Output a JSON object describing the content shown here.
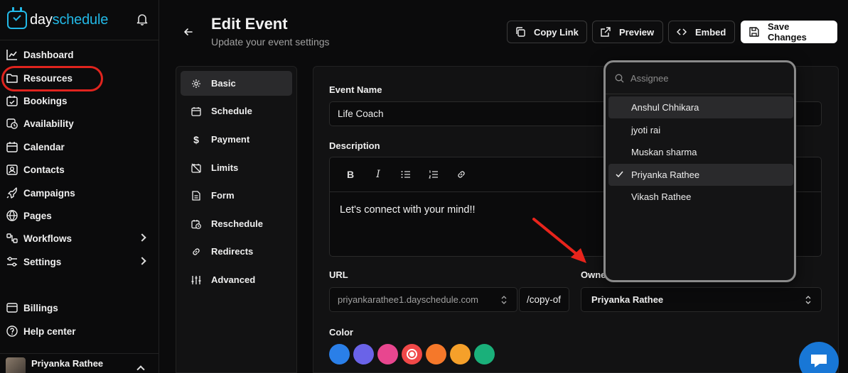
{
  "brand": {
    "name_part1": "day",
    "name_part2": "schedule"
  },
  "sidebar": {
    "items": [
      {
        "label": "Dashboard",
        "icon": "chart-icon"
      },
      {
        "label": "Resources",
        "icon": "folder-icon"
      },
      {
        "label": "Bookings",
        "icon": "calendar-check-icon"
      },
      {
        "label": "Availability",
        "icon": "clock-icon"
      },
      {
        "label": "Calendar",
        "icon": "calendar-icon"
      },
      {
        "label": "Contacts",
        "icon": "contact-icon"
      },
      {
        "label": "Campaigns",
        "icon": "rocket-icon"
      },
      {
        "label": "Pages",
        "icon": "globe-icon"
      },
      {
        "label": "Workflows",
        "icon": "workflow-icon"
      },
      {
        "label": "Settings",
        "icon": "settings-icon"
      },
      {
        "label": "Billings",
        "icon": "credit-card-icon"
      },
      {
        "label": "Help center",
        "icon": "help-icon"
      }
    ],
    "user": {
      "name": "Priyanka Rathee"
    }
  },
  "header": {
    "title": "Edit Event",
    "subtitle": "Update your event settings",
    "copy_link": "Copy Link",
    "preview": "Preview",
    "embed": "Embed",
    "save": "Save Changes"
  },
  "subnav": {
    "items": [
      {
        "label": "Basic",
        "active": true
      },
      {
        "label": "Schedule"
      },
      {
        "label": "Payment"
      },
      {
        "label": "Limits"
      },
      {
        "label": "Form"
      },
      {
        "label": "Reschedule"
      },
      {
        "label": "Redirects"
      },
      {
        "label": "Advanced"
      }
    ]
  },
  "form": {
    "event_name_label": "Event Name",
    "event_name_value": "Life Coach",
    "description_label": "Description",
    "description_value": "Let's connect with your mind!!",
    "url_label": "URL",
    "url_domain": "priyankarathee1.dayschedule.com",
    "url_slug": "/copy-of",
    "owner_label": "Owne",
    "owner_value": "Priyanka Rathee",
    "color_label": "Color",
    "colors": [
      "#2a7fe8",
      "#6a63e8",
      "#e8468f",
      "#f04848",
      "#f5782a",
      "#f5a02a",
      "#1ab07a"
    ]
  },
  "dropdown": {
    "search_placeholder": "Assignee",
    "options": [
      {
        "label": "Anshul Chhikara",
        "state": "hover"
      },
      {
        "label": "jyoti rai"
      },
      {
        "label": "Muskan sharma"
      },
      {
        "label": "Priyanka Rathee",
        "state": "selected"
      },
      {
        "label": "Vikash Rathee"
      }
    ]
  }
}
